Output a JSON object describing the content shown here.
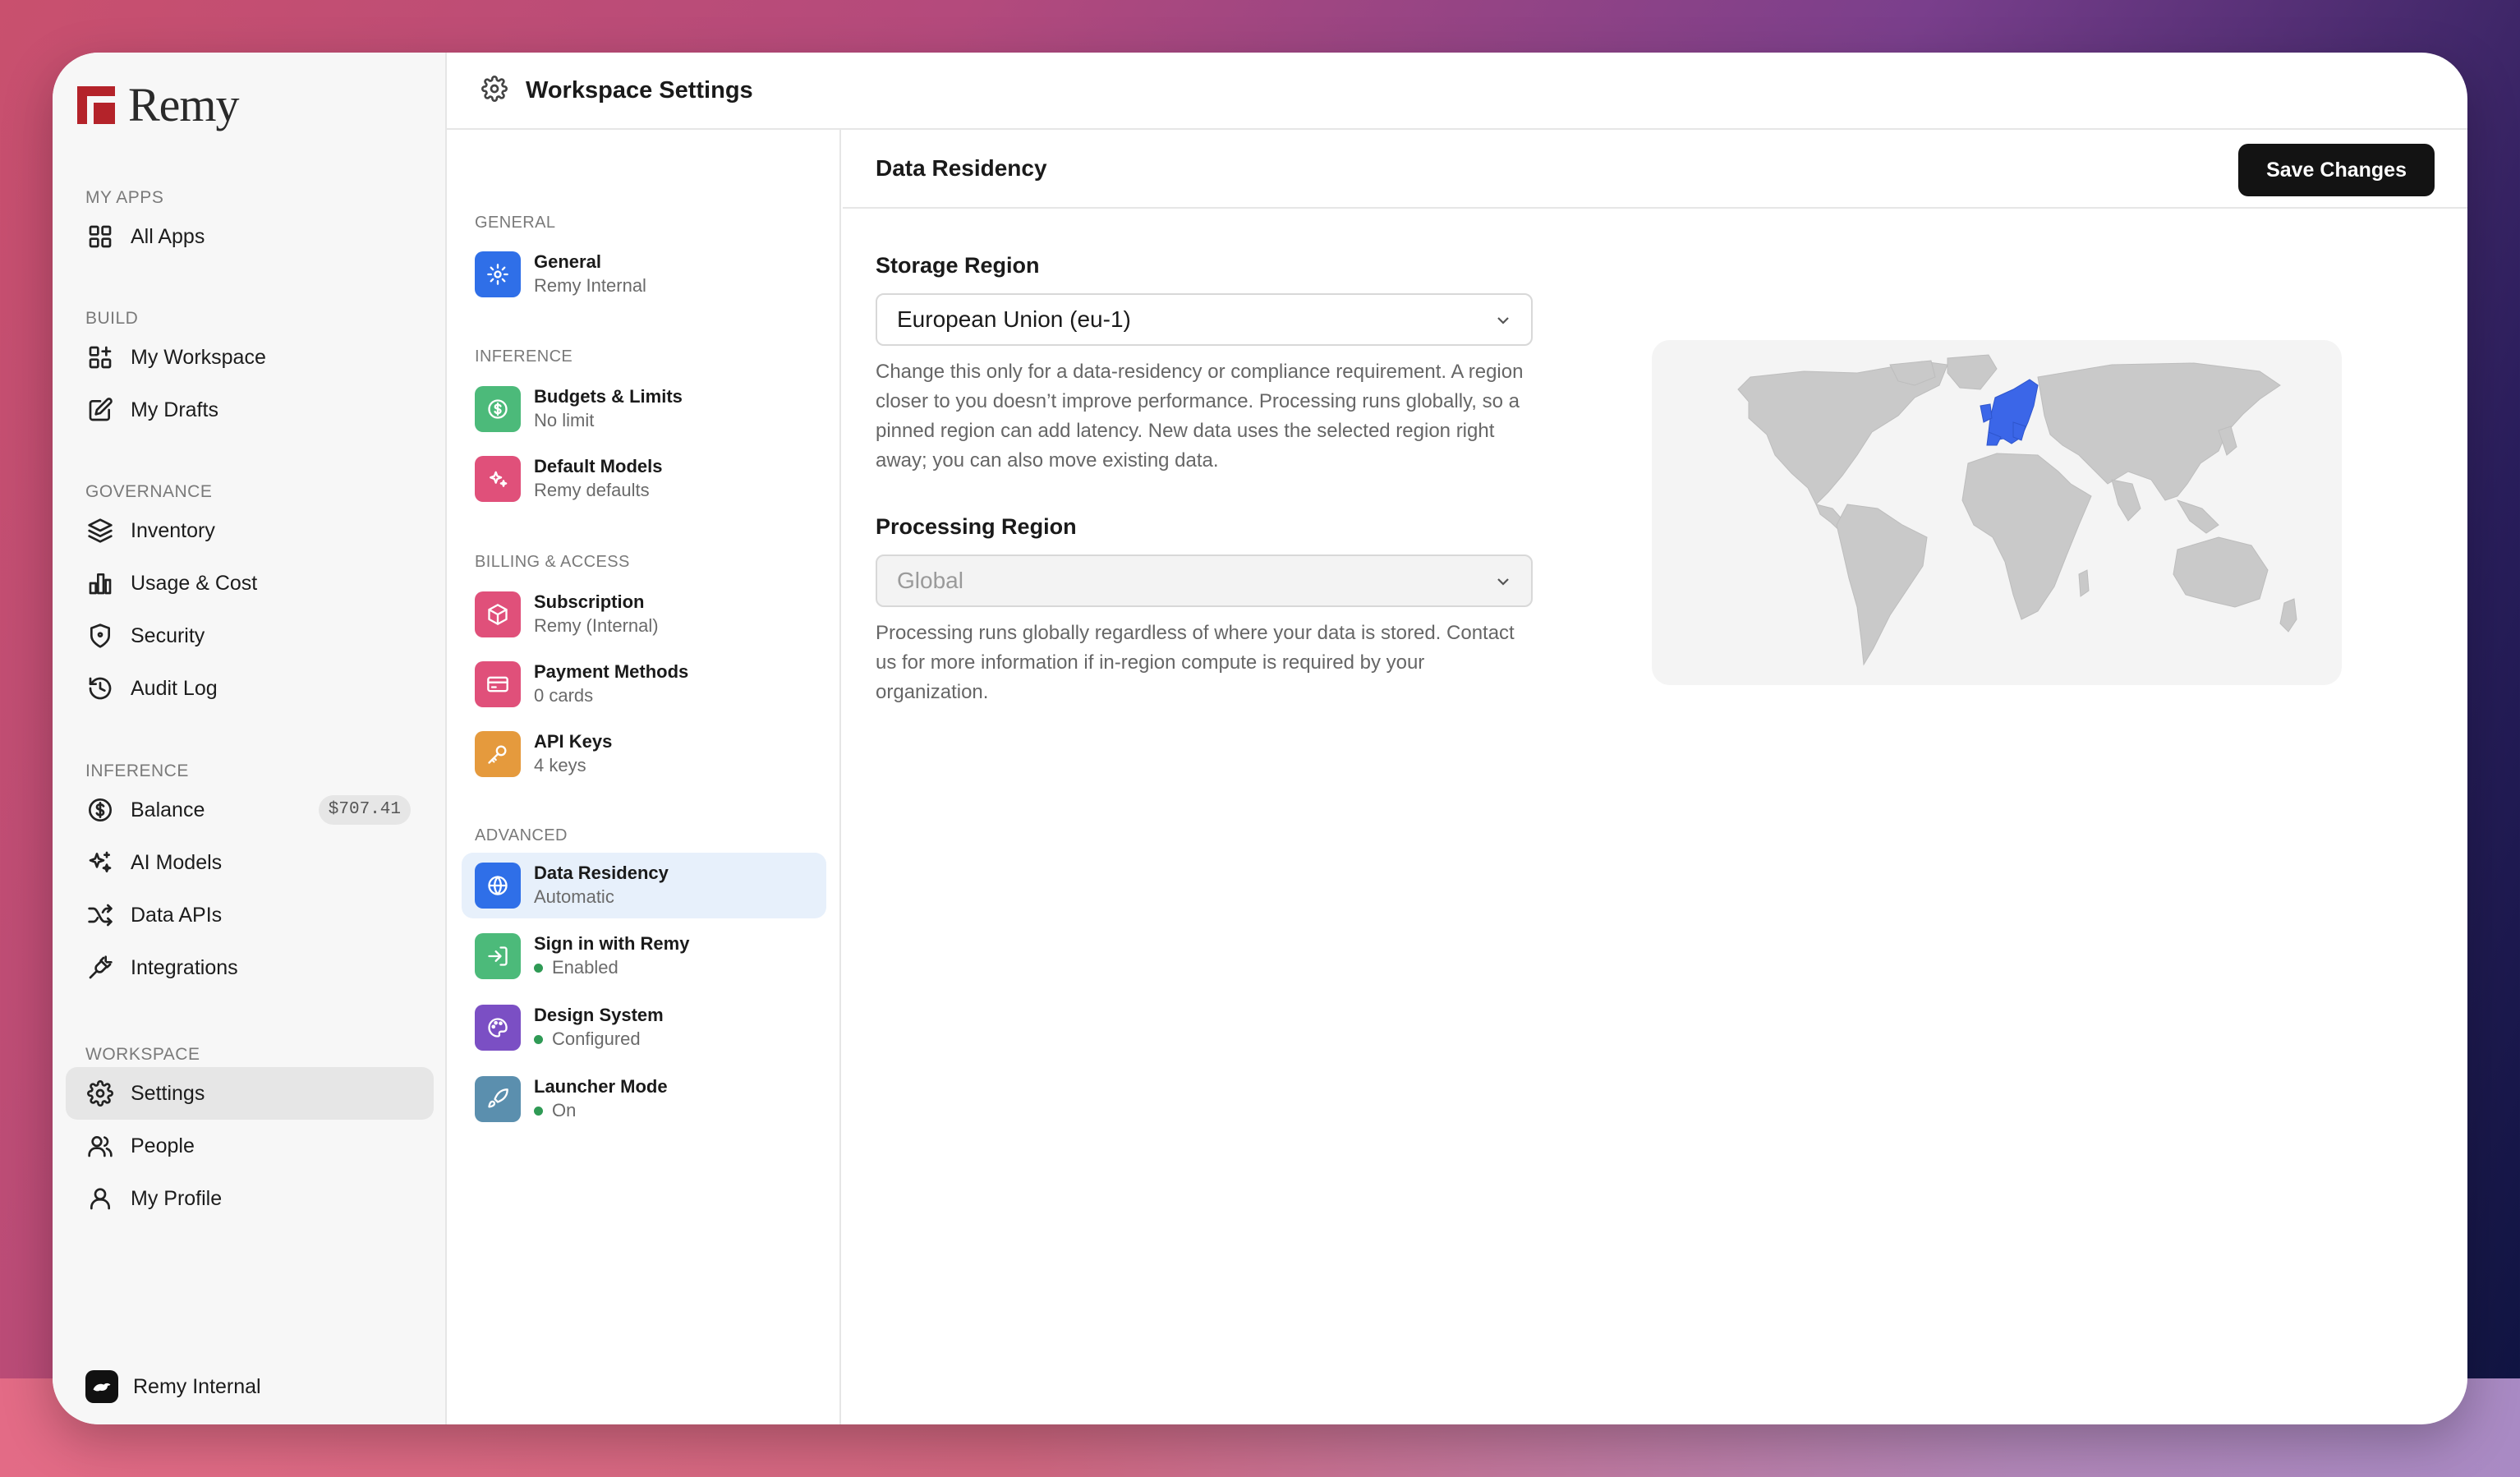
{
  "sidebar": {
    "brand": "Remy",
    "sections": [
      {
        "heading": "MY APPS",
        "items": [
          {
            "label": "All Apps",
            "icon": "grid-icon"
          }
        ]
      },
      {
        "heading": "BUILD",
        "items": [
          {
            "label": "My Workspace",
            "icon": "workspace-icon"
          },
          {
            "label": "My Drafts",
            "icon": "edit-icon"
          }
        ]
      },
      {
        "heading": "GOVERNANCE",
        "items": [
          {
            "label": "Inventory",
            "icon": "layers-icon"
          },
          {
            "label": "Usage & Cost",
            "icon": "bar-chart-icon"
          },
          {
            "label": "Security",
            "icon": "shield-icon"
          },
          {
            "label": "Audit Log",
            "icon": "history-icon"
          }
        ]
      },
      {
        "heading": "INFERENCE",
        "items": [
          {
            "label": "Balance",
            "icon": "dollar-icon",
            "badge": "$707.41"
          },
          {
            "label": "AI Models",
            "icon": "sparkles-icon"
          },
          {
            "label": "Data APIs",
            "icon": "shuffle-icon"
          },
          {
            "label": "Integrations",
            "icon": "plug-icon"
          }
        ]
      },
      {
        "heading": "WORKSPACE",
        "items": [
          {
            "label": "Settings",
            "icon": "gear-icon",
            "active": true
          },
          {
            "label": "People",
            "icon": "users-icon"
          },
          {
            "label": "My Profile",
            "icon": "user-icon"
          }
        ]
      }
    ],
    "footer_workspace": "Remy Internal"
  },
  "header": {
    "title": "Workspace Settings"
  },
  "settings_list": {
    "groups": [
      {
        "heading": "GENERAL",
        "items": [
          {
            "title": "General",
            "subtitle": "Remy Internal",
            "color": "#2f6fe8",
            "icon": "gear-icon"
          }
        ]
      },
      {
        "heading": "INFERENCE",
        "items": [
          {
            "title": "Budgets & Limits",
            "subtitle": "No limit",
            "color": "#4cba7a",
            "icon": "dollar-icon"
          },
          {
            "title": "Default Models",
            "subtitle": "Remy defaults",
            "color": "#e0507a",
            "icon": "sparkles-icon"
          }
        ]
      },
      {
        "heading": "BILLING & ACCESS",
        "items": [
          {
            "title": "Subscription",
            "subtitle": "Remy (Internal)",
            "color": "#e0507a",
            "icon": "box-icon"
          },
          {
            "title": "Payment Methods",
            "subtitle": "0 cards",
            "color": "#e0507a",
            "icon": "credit-card-icon"
          },
          {
            "title": "API Keys",
            "subtitle": "4 keys",
            "color": "#e59a3d",
            "icon": "key-icon"
          }
        ]
      },
      {
        "heading": "ADVANCED",
        "items": [
          {
            "title": "Data Residency",
            "subtitle": "Automatic",
            "color": "#2f6fe8",
            "icon": "globe-icon",
            "active": true
          },
          {
            "title": "Sign in with Remy",
            "subtitle": "Enabled",
            "color": "#4cba7a",
            "icon": "login-icon",
            "status_dot": true
          },
          {
            "title": "Design System",
            "subtitle": "Configured",
            "color": "#7b4fc4",
            "icon": "palette-icon",
            "status_dot": true
          },
          {
            "title": "Launcher Mode",
            "subtitle": "On",
            "color": "#5b8fae",
            "icon": "rocket-icon",
            "status_dot": true
          }
        ]
      }
    ]
  },
  "main": {
    "title": "Data Residency",
    "save_label": "Save Changes",
    "storage": {
      "label": "Storage Region",
      "value": "European Union (eu-1)",
      "help": "Change this only for a data-residency or compliance requirement. A region closer to you doesn’t improve performance. Processing runs globally, so a pinned region can add latency. New data uses the selected region right away; you can also move existing data."
    },
    "processing": {
      "label": "Processing Region",
      "value": "Global",
      "help": "Processing runs globally regardless of where your data is stored. Contact us for more information if in-region compute is required by your organization."
    },
    "map": {
      "highlighted_region": "Europe",
      "highlight_color": "#3b66e8",
      "land_color": "#c9c9c9"
    }
  }
}
